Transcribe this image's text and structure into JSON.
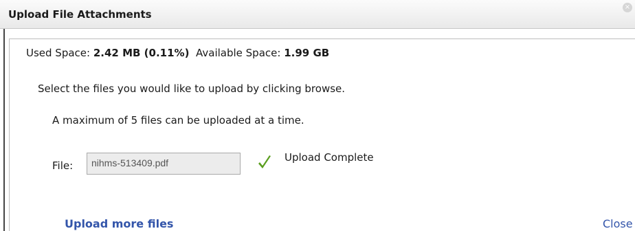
{
  "dialog": {
    "title": "Upload File Attachments",
    "close_glyph": "×"
  },
  "space": {
    "used_label": "Used Space:",
    "used_value": "2.42 MB (0.11%)",
    "available_label": "Available Space:",
    "available_value": "1.99 GB"
  },
  "instructions": "Select the files you would like to upload by clicking browse.",
  "max_files_note": "A maximum of 5 files can be uploaded at a time.",
  "file_row": {
    "label": "File:",
    "value": "nihms-513409.pdf",
    "status_icon": "checkmark-icon",
    "status_text": "Upload Complete",
    "status_color": "#5a9e1e"
  },
  "actions": {
    "upload_more": "Upload more files",
    "close": "Close"
  },
  "colors": {
    "link": "#3355aa",
    "title_bar": "#efefef"
  }
}
